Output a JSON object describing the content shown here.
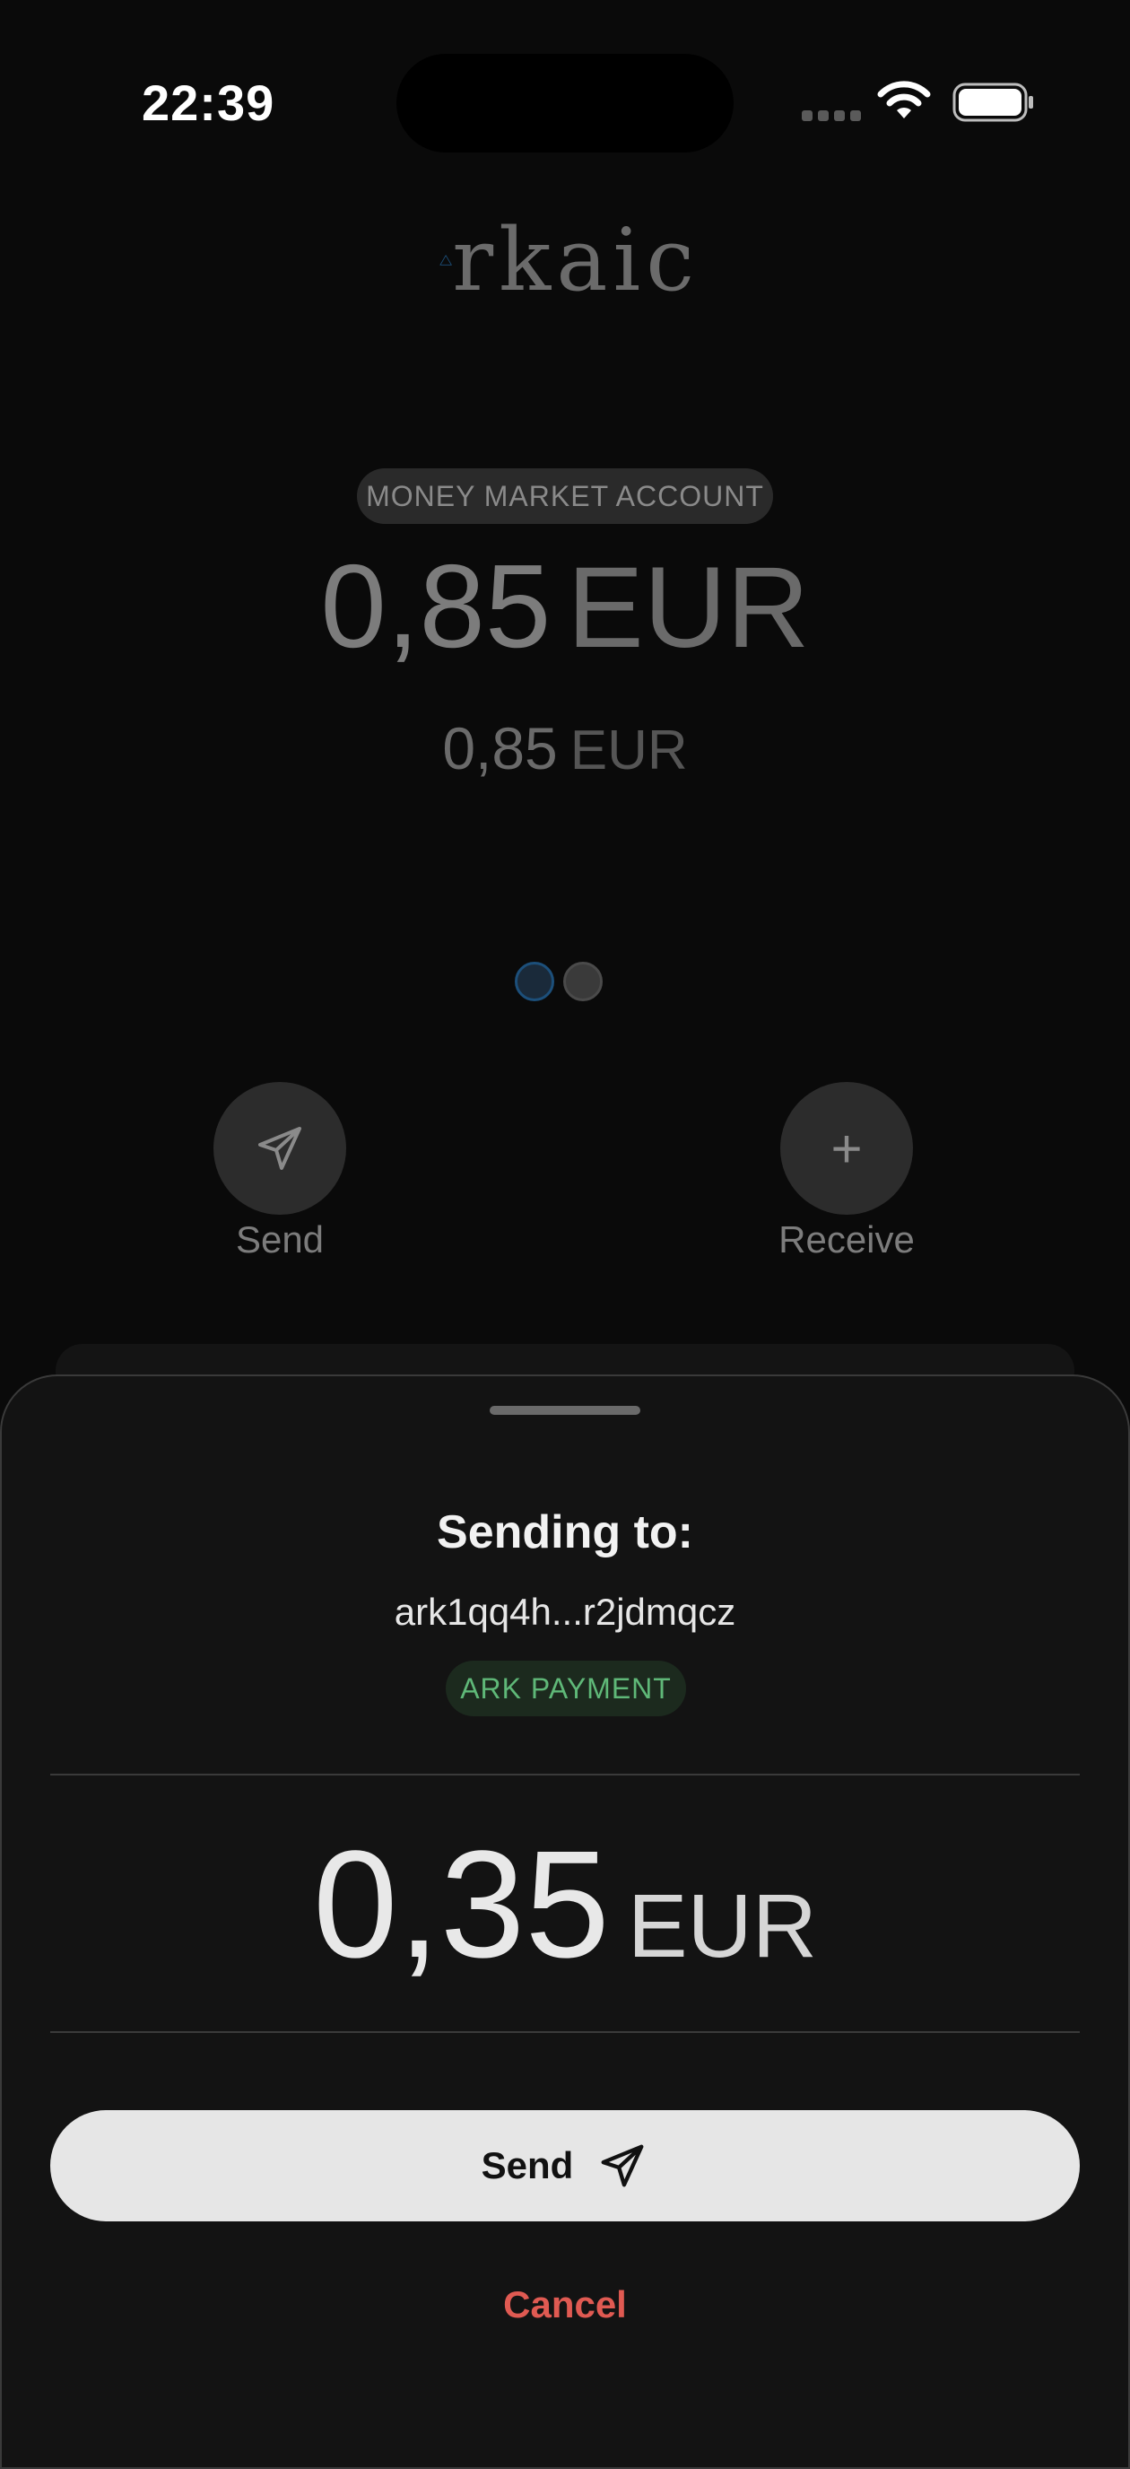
{
  "status_bar": {
    "time": "22:39"
  },
  "background": {
    "logo_text": "rkaic",
    "account_label": "MONEY MARKET ACCOUNT",
    "balance_value": "0,85",
    "balance_currency": "EUR",
    "sub_balance_value": "0,85",
    "sub_balance_currency": "EUR",
    "send_label": "Send",
    "receive_label": "Receive",
    "receive_icon": "+"
  },
  "sheet": {
    "title": "Sending to:",
    "address": "ark1qq4h...r2jdmqcz",
    "payment_type": "ARK PAYMENT",
    "amount_value": "0,35",
    "amount_currency": "EUR",
    "send_button_label": "Send",
    "cancel_label": "Cancel"
  },
  "colors": {
    "accent_blue": "#1c4f7a",
    "payment_green": "#5fb878",
    "cancel_red": "#e05a52"
  }
}
